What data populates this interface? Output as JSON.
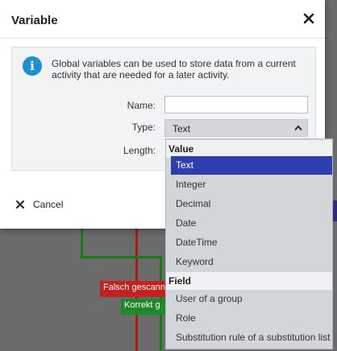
{
  "dialog": {
    "title": "Variable",
    "info_text": "Global variables can be used to store data from a current activity that are needed for a later activity.",
    "name_label": "Name:",
    "name_value": "",
    "type_label": "Type:",
    "type_value": "Text",
    "length_label": "Length:",
    "cancel_label": "Cancel"
  },
  "dropdown": {
    "groups": [
      {
        "label": "Value",
        "items": [
          "Text",
          "Integer",
          "Decimal",
          "Date",
          "DateTime",
          "Keyword"
        ]
      },
      {
        "label": "Field",
        "items": [
          "User of a group",
          "Role",
          "Substitution rule of a substitution list"
        ]
      }
    ],
    "selected": "Text"
  },
  "background": {
    "node_red_label": "Falsch gescann",
    "node_green_label": "Korrekt g"
  },
  "colors": {
    "selected_bg": "#2f3eae",
    "info_icon": "#1e8fd3",
    "panel_bg": "#f1f3f4"
  }
}
